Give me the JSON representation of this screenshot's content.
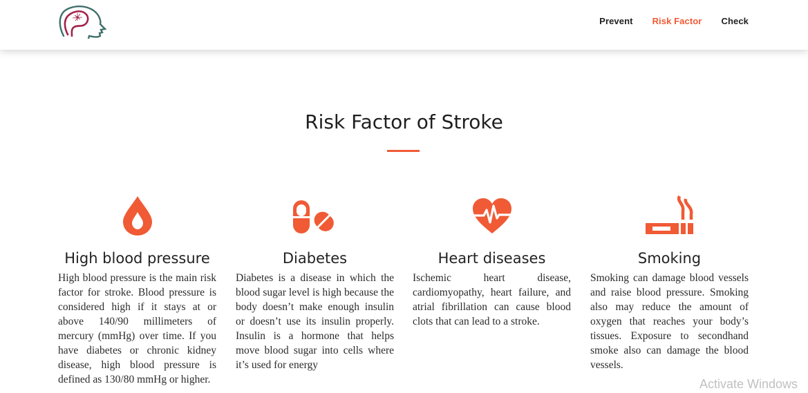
{
  "header": {
    "nav": [
      {
        "label": "Prevent",
        "active": false
      },
      {
        "label": "Risk Factor",
        "active": true
      },
      {
        "label": "Check",
        "active": false
      }
    ]
  },
  "main": {
    "title": "Risk Factor of Stroke",
    "cards": [
      {
        "icon": "blood-drop-icon",
        "title": "High blood pressure",
        "text": "High blood pressure is the main risk factor for stroke. Blood pressure is considered high if it stays at or above 140/90 millimeters of mercury (mmHg) over time. If you have diabetes or chronic kidney disease, high blood pressure is defined as 130/80 mmHg or higher."
      },
      {
        "icon": "pills-icon",
        "title": "Diabetes",
        "text": "Diabetes is a disease in which the blood sugar level is high because the body doesn’t make enough insulin or doesn’t use its insulin properly. Insulin is a hormone that helps move blood sugar into cells where it’s used for energy"
      },
      {
        "icon": "heartbeat-icon",
        "title": "Heart diseases",
        "text": "Ischemic heart disease, cardiomyopathy, heart failure, and atrial fibrillation can cause blood clots that can lead to a stroke."
      },
      {
        "icon": "cigarette-icon",
        "title": "Smoking",
        "text": "Smoking can damage blood vessels and raise blood pressure. Smoking also may reduce the amount of oxygen that reaches your body’s tissues. Exposure to secondhand smoke also can damage the blood vessels."
      }
    ]
  },
  "watermark": "Activate Windows",
  "colors": {
    "accent": "#f05a35",
    "logo_outline": "#3f6f6a",
    "logo_brain": "#a3224a"
  }
}
